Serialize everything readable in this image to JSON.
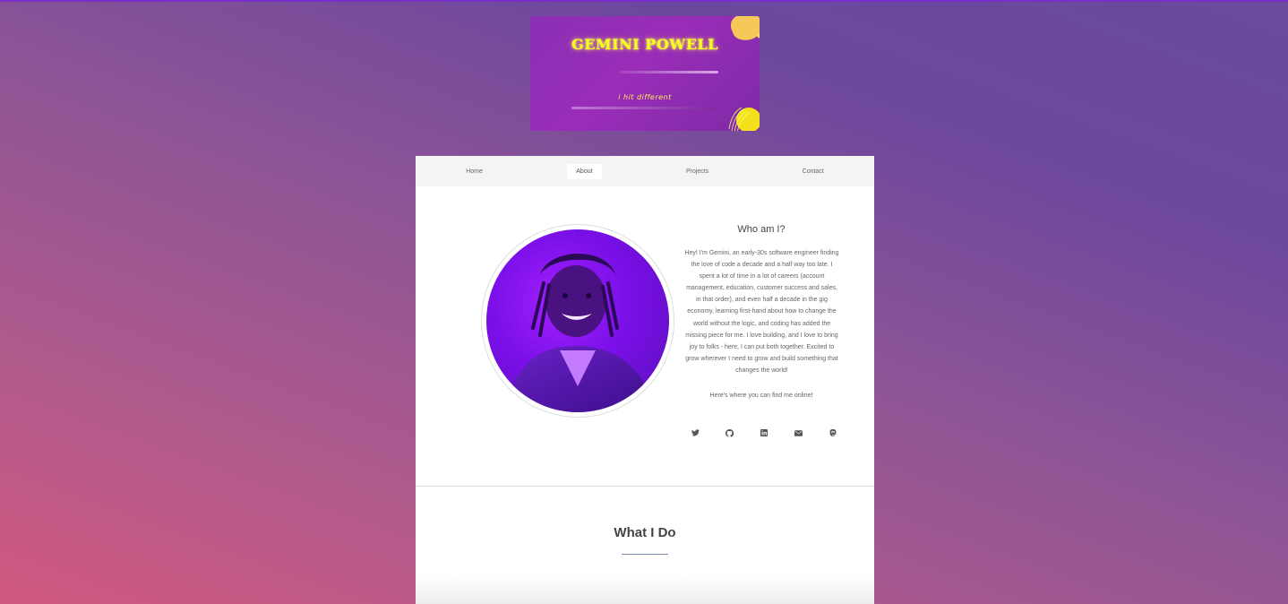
{
  "banner": {
    "title": "GEMINI POWELL",
    "tagline": "i hit different",
    "colors": {
      "background": "#8a2fb3",
      "title": "#f6ff1a",
      "accent_blob": "#ffd83a"
    }
  },
  "nav": {
    "items": [
      {
        "label": "Home",
        "active": false
      },
      {
        "label": "About",
        "active": true
      },
      {
        "label": "Projects",
        "active": false
      },
      {
        "label": "Contact",
        "active": false
      }
    ]
  },
  "about": {
    "heading": "Who am I?",
    "bio": "Hey! I'm Gemini, an early-30s software engineer finding the love of code a decade and a half way too late. I spent a lot of time in a lot of careers (account management, education, customer success and sales, in that order), and even half a decade in the gig economy, learning first-hand about how to change the world without the logic, and coding has added the missing piece for me. I love building, and I love to bring joy to folks - here, I can put both together. Excited to grow wherever I need to grow and build something that changes the world!",
    "find_me": "Here's where you can find me online!",
    "socials": [
      {
        "icon": "twitter-icon"
      },
      {
        "icon": "github-icon"
      },
      {
        "icon": "linkedin-icon"
      },
      {
        "icon": "email-icon"
      },
      {
        "icon": "mastodon-icon"
      }
    ]
  },
  "what_i_do": {
    "heading": "What I Do"
  },
  "colors": {
    "page_gradient_start": "#d0587f",
    "page_gradient_end": "#6a4a9c",
    "card": "#ffffff",
    "nav_bg": "#f4f4f4"
  }
}
